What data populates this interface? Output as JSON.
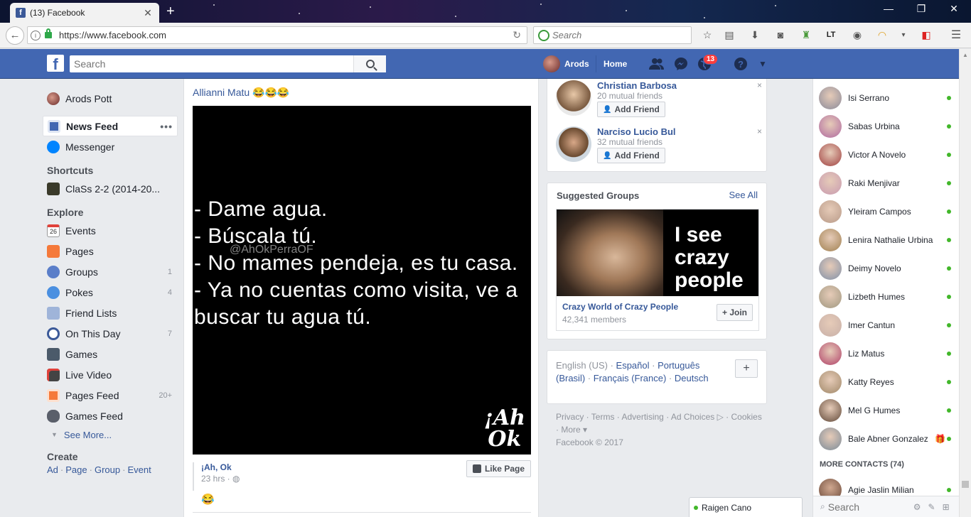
{
  "browser": {
    "tab_title": "(13) Facebook",
    "url": "https://www.facebook.com",
    "search_placeholder": "Search"
  },
  "fb_header": {
    "search_placeholder": "Search",
    "user_name": "Arods",
    "home_label": "Home",
    "notification_count": "13",
    "brand_color": "#4267b2"
  },
  "left_nav": {
    "profile_name": "Arods Pott",
    "news_feed": "News Feed",
    "news_feed_more": "•••",
    "messenger": "Messenger",
    "shortcuts_heading": "Shortcuts",
    "shortcut_item": "ClaSs 2-2 (2014-20...",
    "explore_heading": "Explore",
    "explore": [
      {
        "label": "Events",
        "count": ""
      },
      {
        "label": "Pages",
        "count": ""
      },
      {
        "label": "Groups",
        "count": "1"
      },
      {
        "label": "Pokes",
        "count": "4"
      },
      {
        "label": "Friend Lists",
        "count": ""
      },
      {
        "label": "On This Day",
        "count": "7"
      },
      {
        "label": "Games",
        "count": ""
      },
      {
        "label": "Live Video",
        "count": ""
      },
      {
        "label": "Pages Feed",
        "count": "20+"
      },
      {
        "label": "Games Feed",
        "count": ""
      }
    ],
    "events_day": "26",
    "see_more": "See More...",
    "create_heading": "Create",
    "create_links": [
      "Ad",
      "Page",
      "Group",
      "Event"
    ],
    "create_sep": "·"
  },
  "post": {
    "author": "Allianni Matu 😂😂😂",
    "image_lines": [
      "- Dame agua.",
      "- Búscala tú.",
      "- No mames pendeja, es tu casa.",
      "- Ya no cuentas como visita, ve a buscar tu agua tú."
    ],
    "watermark": "@AhOkPerraOF",
    "logo_line1": "¡Ah",
    "logo_line2": "Ok",
    "page_name": "¡Ah, Ok",
    "time": "23 hrs · ◍",
    "like_page": "Like Page",
    "emoji": "😂"
  },
  "pymk": [
    {
      "name": "Christian Barbosa",
      "mutual": "20 mutual friends",
      "button": "Add Friend"
    },
    {
      "name": "Narciso Lucio Bul",
      "mutual": "32 mutual friends",
      "button": "Add Friend"
    }
  ],
  "pymk_close": "×",
  "groups": {
    "heading": "Suggested Groups",
    "see_all": "See All",
    "image_text": "I see crazy people",
    "name": "Crazy World of Crazy People",
    "members": "42,341 members",
    "join": "Join"
  },
  "languages": {
    "current": "English (US)",
    "options": [
      "Español",
      "Português (Brasil)",
      "Français (France)",
      "Deutsch"
    ],
    "sep": " · ",
    "plus": "+"
  },
  "footer": {
    "links": [
      "Privacy",
      "Terms",
      "Advertising",
      "Ad Choices ▷",
      "Cookies",
      "More ▾"
    ],
    "sep": " · ",
    "copyright": "Facebook © 2017"
  },
  "chat": {
    "contacts": [
      "Isi Serrano",
      "Sabas Urbina",
      "Victor A Novelo",
      "Raki Menjivar",
      "Yleiram Campos",
      "Lenira Nathalie Urbina",
      "Deimy Novelo",
      "Lizbeth Humes",
      "Imer Cantun",
      "Liz Matus",
      "Katty Reyes",
      "Mel G Humes",
      "Bale Abner Gonzalez"
    ],
    "more_contacts": "MORE CONTACTS (74)",
    "more_contact_1": "Agie Jaslin Milian",
    "search_placeholder": "Search",
    "online_color": "#42b72a",
    "open_chat": "Raigen Cano"
  }
}
